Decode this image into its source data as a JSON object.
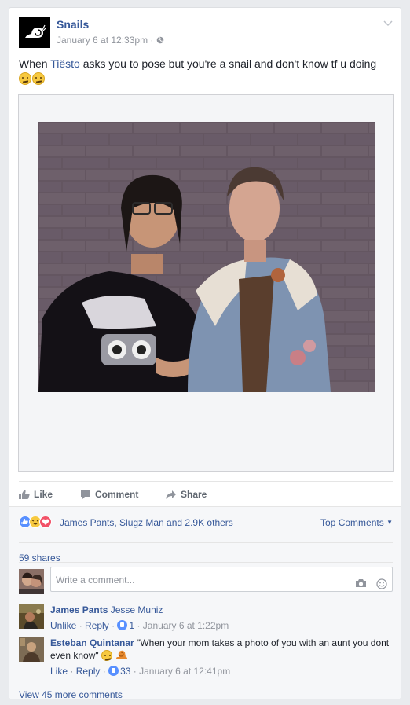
{
  "post": {
    "page_name": "Snails",
    "timestamp": "January 6 at 12:33pm",
    "privacy_icon": "globe-icon",
    "text_before": "When ",
    "text_link": "Tiësto",
    "text_after": " asks you to pose but you're a snail and don't know tf u doing",
    "emoji": [
      "confused-face",
      "confused-face"
    ]
  },
  "actions": {
    "like": "Like",
    "comment": "Comment",
    "share": "Share"
  },
  "feedback": {
    "reaction_icons": [
      "like-icon",
      "haha-icon",
      "love-icon"
    ],
    "reaction_names": "James Pants, Slugz Man and 2.9K others",
    "sort_label": "Top Comments",
    "shares": "59 shares",
    "composer_placeholder": "Write a comment...",
    "view_more": "View 45 more comments"
  },
  "comments": [
    {
      "author": "James Pants",
      "text": "",
      "tag": "Jesse Muniz",
      "action1": "Unlike",
      "action2": "Reply",
      "likes": "1",
      "time": "January 6 at 1:22pm"
    },
    {
      "author": "Esteban Quintanar",
      "text": "\"When your mom takes a photo of you with an aunt you dont even know\"",
      "tag": "",
      "action1": "Like",
      "action2": "Reply",
      "likes": "33",
      "time": "January 6 at 12:41pm"
    }
  ],
  "colors": {
    "link": "#365899",
    "meta": "#90949c",
    "background": "#e9ebee"
  }
}
